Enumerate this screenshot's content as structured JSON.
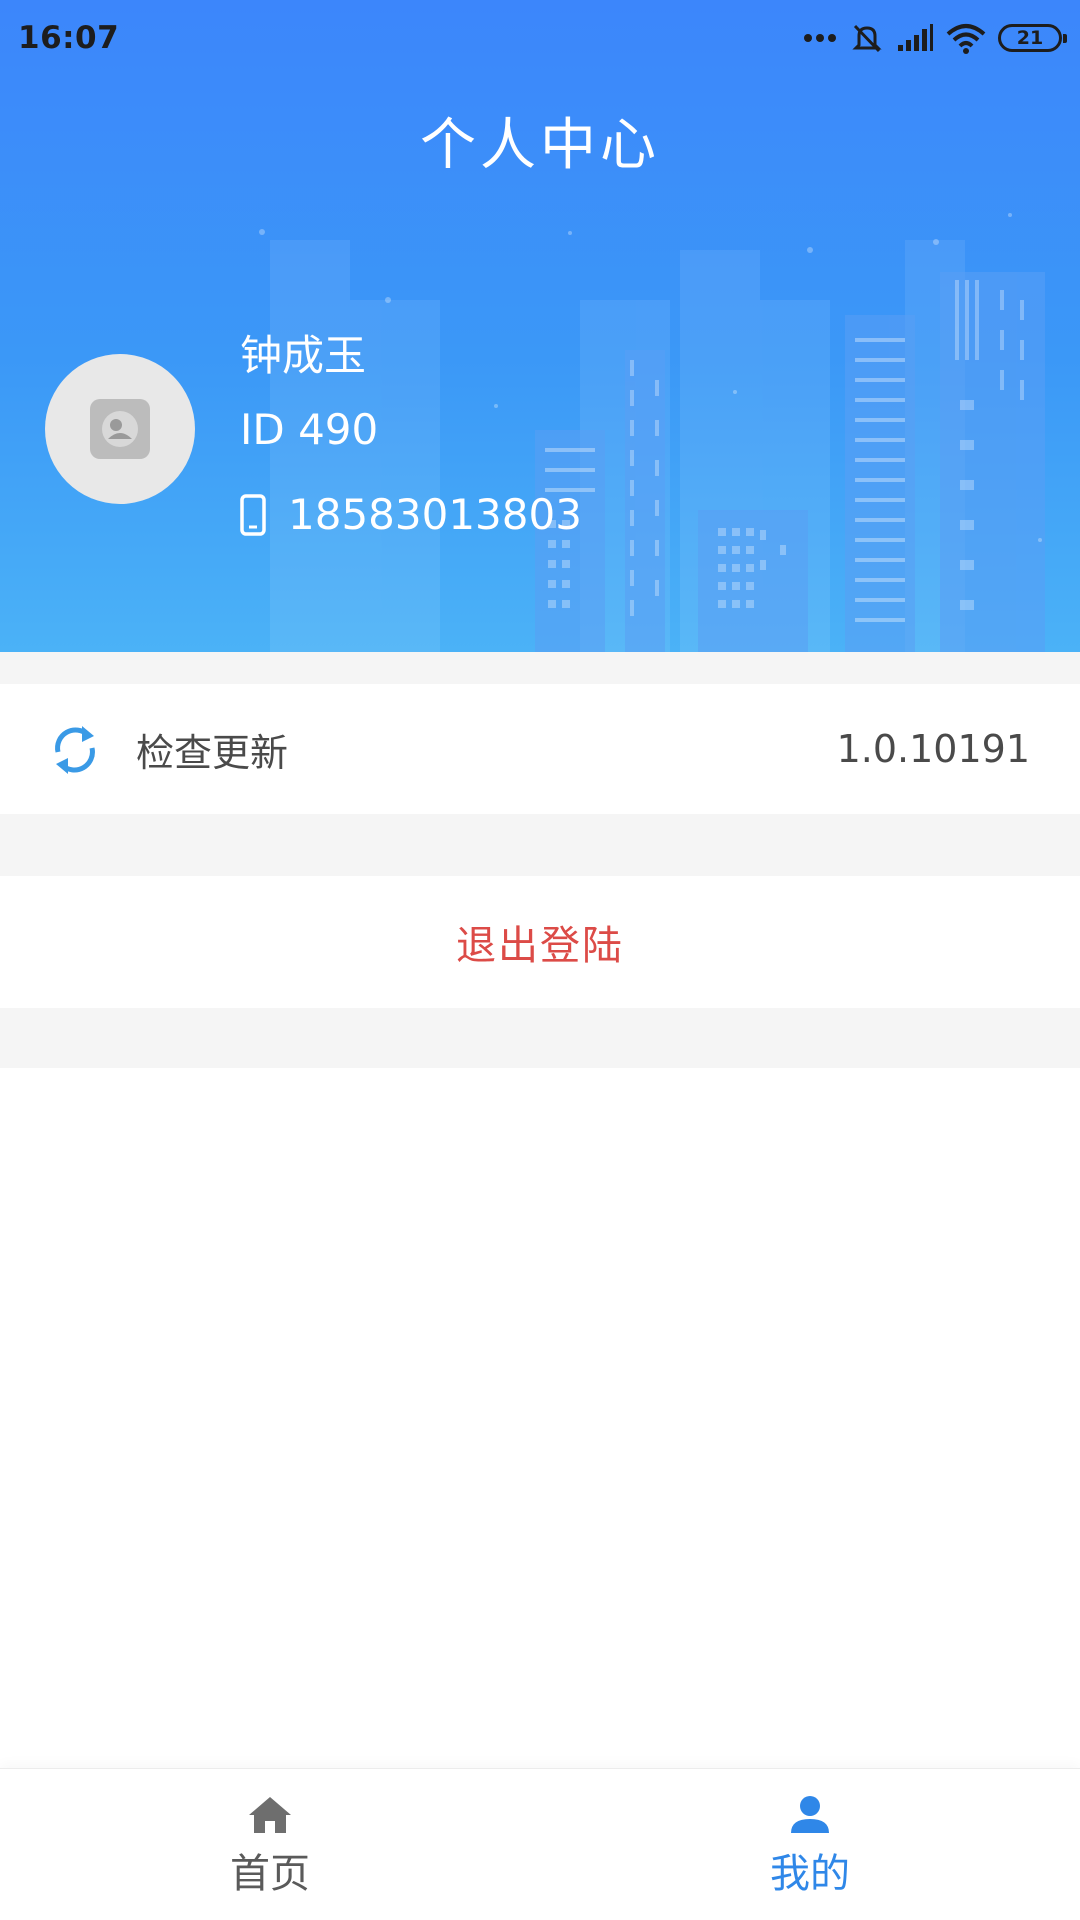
{
  "status_bar": {
    "time": "16:07",
    "battery": "21"
  },
  "header": {
    "title": "个人中心"
  },
  "profile": {
    "name": "钟成玉",
    "id": "ID 490",
    "phone": "18583013803"
  },
  "menu": {
    "check_update_label": "检查更新",
    "version": "1.0.10191",
    "logout_label": "退出登陆"
  },
  "tabbar": {
    "home_label": "首页",
    "mine_label": "我的",
    "active": "我的"
  },
  "colors": {
    "header_blue": "#3c86fb",
    "accent_blue": "#2f87e8",
    "logout_red": "#dc4b47",
    "gray_background": "#f5f5f5"
  },
  "icons": {
    "update": "refresh-icon",
    "phone": "phone-icon",
    "home": "home-icon",
    "mine": "user-icon"
  }
}
